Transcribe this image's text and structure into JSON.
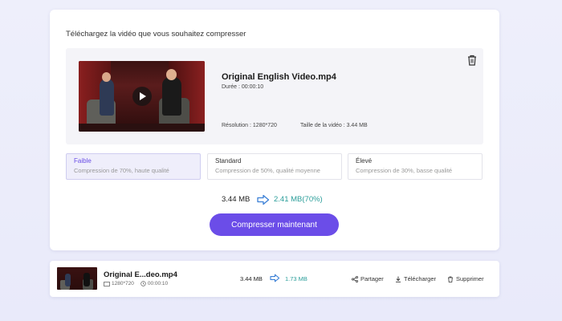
{
  "upload": {
    "heading": "Téléchargez la vidéo que vous souhaitez compresser",
    "video": {
      "title": "Original English Video.mp4",
      "duration": "Durée : 00:00:10",
      "resolution": "Résolution : 1280*720",
      "size": "Taille de la vidéo : 3.44 MB"
    },
    "options": [
      {
        "title": "Faible",
        "desc": "Compression de 70%, haute qualité",
        "selected": true
      },
      {
        "title": "Standard",
        "desc": "Compression de 50%, qualité moyenne",
        "selected": false
      },
      {
        "title": "Élevé",
        "desc": "Compression de 30%, basse qualité",
        "selected": false
      }
    ],
    "compare": {
      "from": "3.44 MB",
      "to": "2.41 MB(70%)"
    },
    "button_label": "Compresser maintenant"
  },
  "result": {
    "title": "Original E...deo.mp4",
    "resolution": "1280*720",
    "duration": "00:00:10",
    "from": "3.44 MB",
    "to": "1.73 MB",
    "actions": {
      "share": "Partager",
      "download": "Télécharger",
      "delete": "Supprimer"
    }
  },
  "icons": [
    "trash-icon",
    "play-icon",
    "arrow-right-icon",
    "share-icon",
    "download-icon",
    "delete-icon",
    "resolution-icon",
    "clock-icon"
  ],
  "colors": {
    "accent": "#6b4de8",
    "teal": "#2b9e9a"
  }
}
